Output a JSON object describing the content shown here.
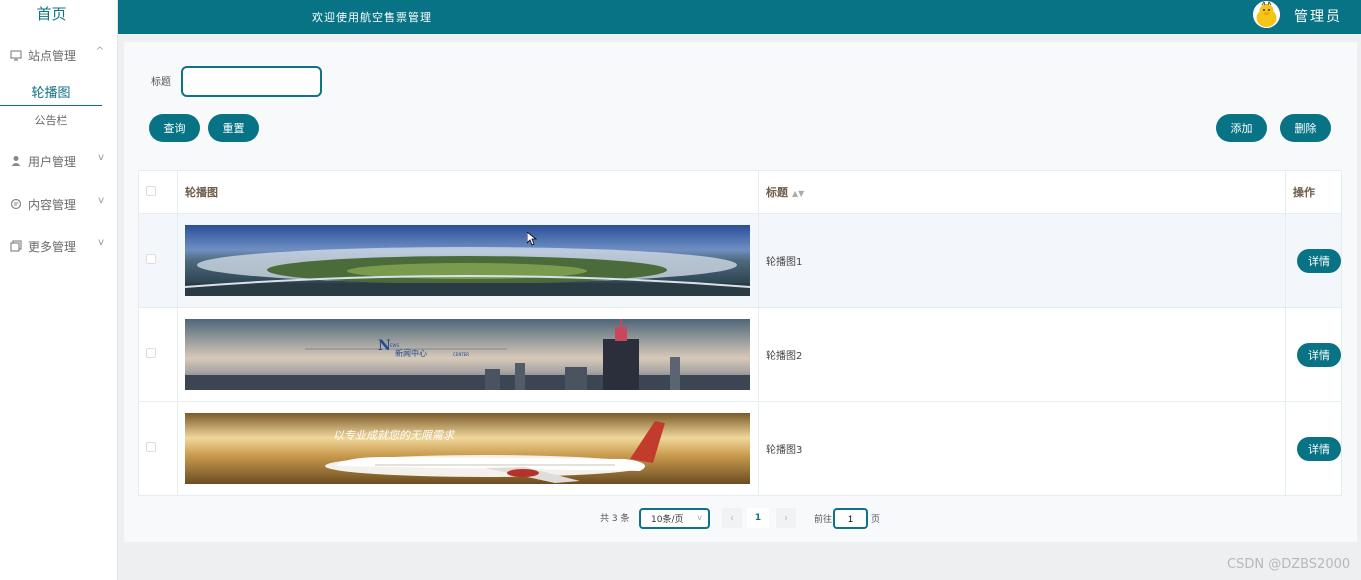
{
  "sidebar": {
    "home": "首页",
    "groups": [
      {
        "label": "站点管理",
        "icon": "monitor-icon",
        "expanded": true
      },
      {
        "label": "用户管理",
        "icon": "user-icon",
        "expanded": false
      },
      {
        "label": "内容管理",
        "icon": "chat-icon",
        "expanded": false
      },
      {
        "label": "更多管理",
        "icon": "copy-icon",
        "expanded": false
      }
    ],
    "sub_items": [
      {
        "label": "轮播图",
        "active": true
      },
      {
        "label": "公告栏",
        "active": false
      }
    ]
  },
  "header": {
    "welcome": "欢迎使用航空售票管理",
    "user": "管理员",
    "avatar_icon": "duck-avatar-icon"
  },
  "search": {
    "title_label": "标题",
    "title_value": "",
    "query_button": "查询",
    "reset_button": "重置",
    "add_button": "添加",
    "delete_button": "删除"
  },
  "table": {
    "columns": [
      "轮播图",
      "标题",
      "操作"
    ],
    "rows": [
      {
        "title": "轮播图1",
        "action": "详情",
        "image": "airport-aerial"
      },
      {
        "title": "轮播图2",
        "action": "详情",
        "image": "news-center-city"
      },
      {
        "title": "轮播图3",
        "action": "详情",
        "image": "airplane-sunset"
      }
    ],
    "image_texts": {
      "news_n": "N",
      "news_ews": "EWS",
      "news_cn": "新闻中心",
      "news_center": "CENTER",
      "plane_slogan": "以专业成就您的无限需求"
    }
  },
  "pagination": {
    "total": "共 3 条",
    "page_size": "10条/页",
    "prev": "‹",
    "current": "1",
    "next": "›",
    "goto_prefix": "前往",
    "goto_value": "1",
    "goto_suffix": "页"
  },
  "watermark": "CSDN @DZBS2000",
  "colors": {
    "primary": "#087384",
    "header_bg": "#087384",
    "sidebar_bg": "#ffffff",
    "page_bg": "#eeeff1"
  }
}
